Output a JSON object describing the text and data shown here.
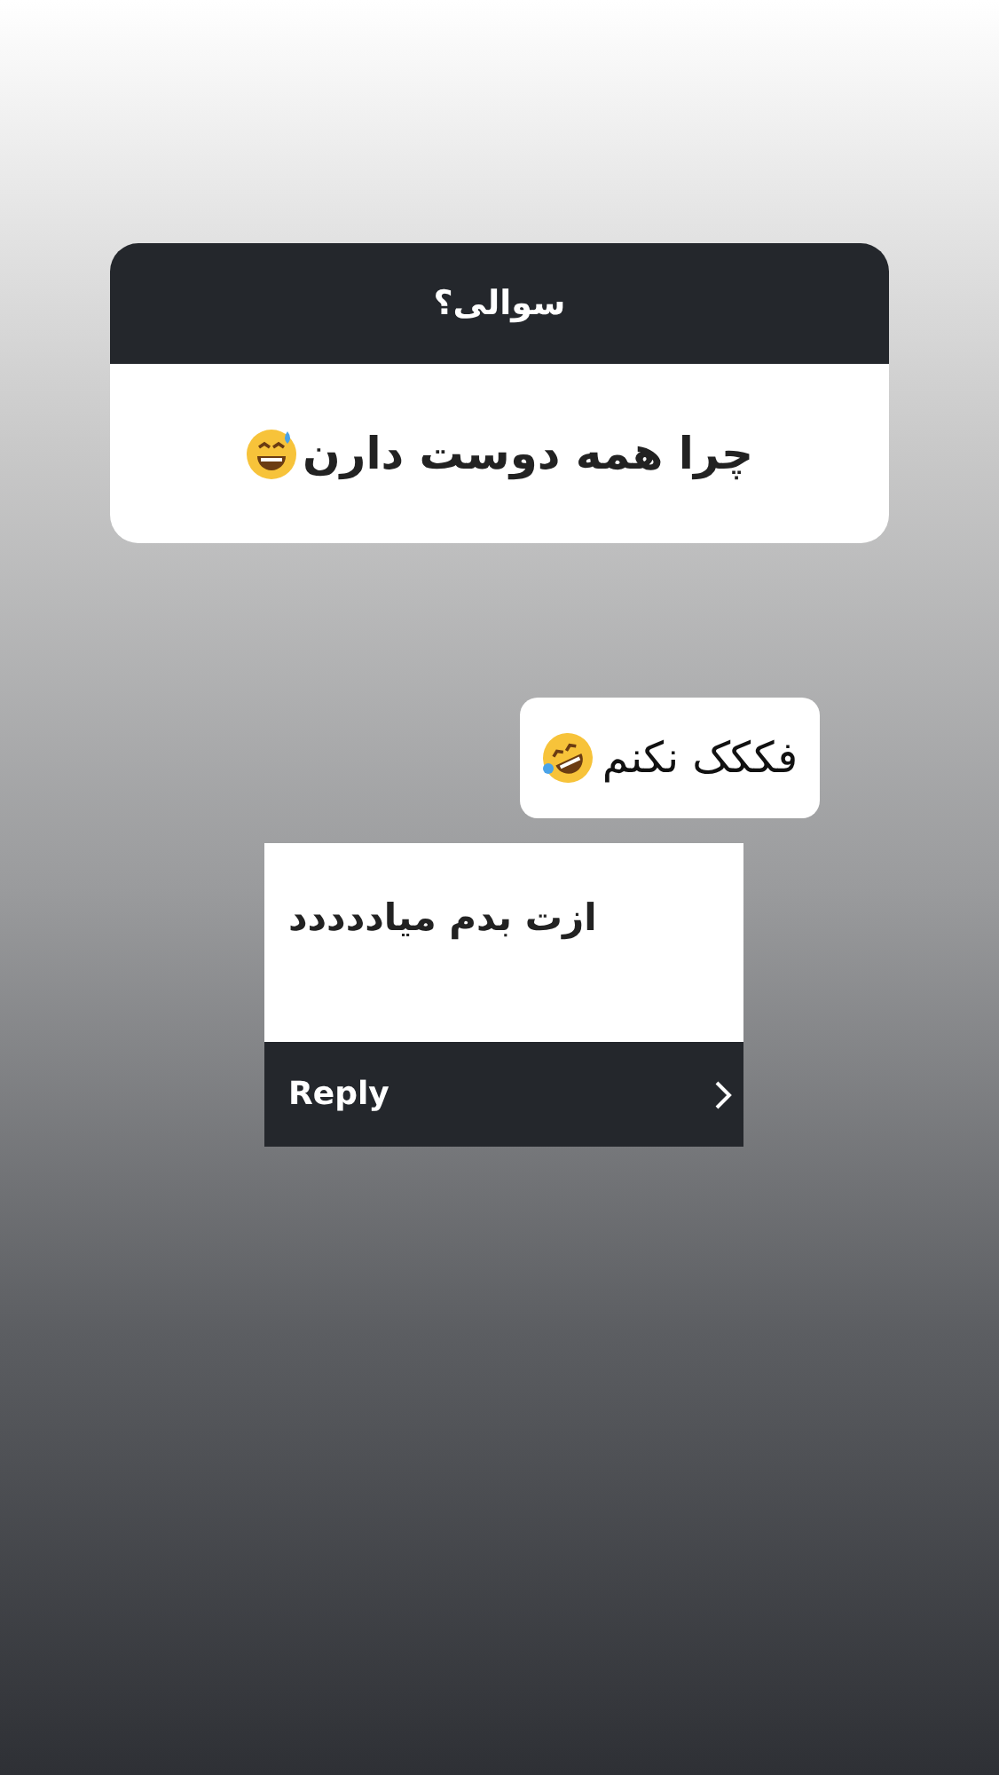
{
  "question_card": {
    "title": "سوالی؟",
    "question": "چرا همه دوست دارن"
  },
  "answer_sticker": {
    "text": "فککک نکنم"
  },
  "reply_card": {
    "message": "ازت بدم میاددددد",
    "action": "Reply"
  }
}
